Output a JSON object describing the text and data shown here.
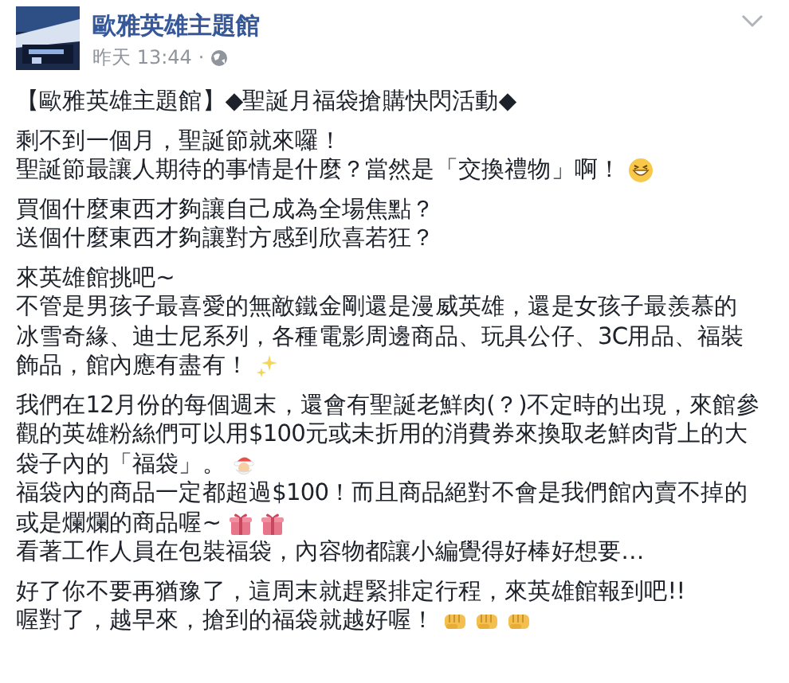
{
  "post": {
    "author": "歐雅英雄主題館",
    "time": "昨天 13:44",
    "separator": "·"
  },
  "paragraphs": [
    [
      {
        "text": "【歐雅英雄主題館】◆聖誕月福袋搶購快閃活動◆"
      }
    ],
    [
      {
        "text": "剩不到一個月，聖誕節就來囉！"
      },
      {
        "text": "聖誕節最讓人期待的事情是什麼？當然是「交換禮物」啊！",
        "emoji": [
          {
            "kind": "grin"
          }
        ]
      }
    ],
    [
      {
        "text": "買個什麼東西才夠讓自己成為全場焦點？"
      },
      {
        "text": "送個什麼東西才夠讓對方感到欣喜若狂？"
      }
    ],
    [
      {
        "text": "來英雄館挑吧~"
      },
      {
        "text": "不管是男孩子最喜愛的無敵鐵金剛還是漫威英雄，還是女孩子最羨慕的"
      },
      {
        "text": "冰雪奇緣、迪士尼系列，各種電影周邊商品、玩具公仔、3C用品、福裝"
      },
      {
        "text": "飾品，館內應有盡有！",
        "emoji": [
          {
            "kind": "sparkle"
          }
        ]
      }
    ],
    [
      {
        "text": "我們在12月份的每個週末，還會有聖誕老鮮肉(？)不定時的出現，來館參"
      },
      {
        "text": "觀的英雄粉絲們可以用$100元或未折用的消費券來換取老鮮肉背上的大"
      },
      {
        "text": "袋子內的「福袋」。",
        "emoji": [
          {
            "kind": "santa"
          }
        ]
      },
      {
        "text": "福袋內的商品一定都超過$100！而且商品絕對不會是我們館內賣不掉的"
      },
      {
        "text": "或是爛爛的商品喔~",
        "emoji": [
          {
            "kind": "gift"
          },
          {
            "kind": "gift"
          }
        ]
      },
      {
        "text": "看著工作人員在包裝福袋，內容物都讓小編覺得好棒好想要…"
      }
    ],
    [
      {
        "text": "好了你不要再猶豫了，這周末就趕緊排定行程，來英雄館報到吧!!"
      },
      {
        "text": "喔對了，越早來，搶到的福袋就越好喔！",
        "emoji": [
          {
            "kind": "fist"
          },
          {
            "kind": "fist"
          },
          {
            "kind": "fist"
          }
        ]
      }
    ]
  ]
}
